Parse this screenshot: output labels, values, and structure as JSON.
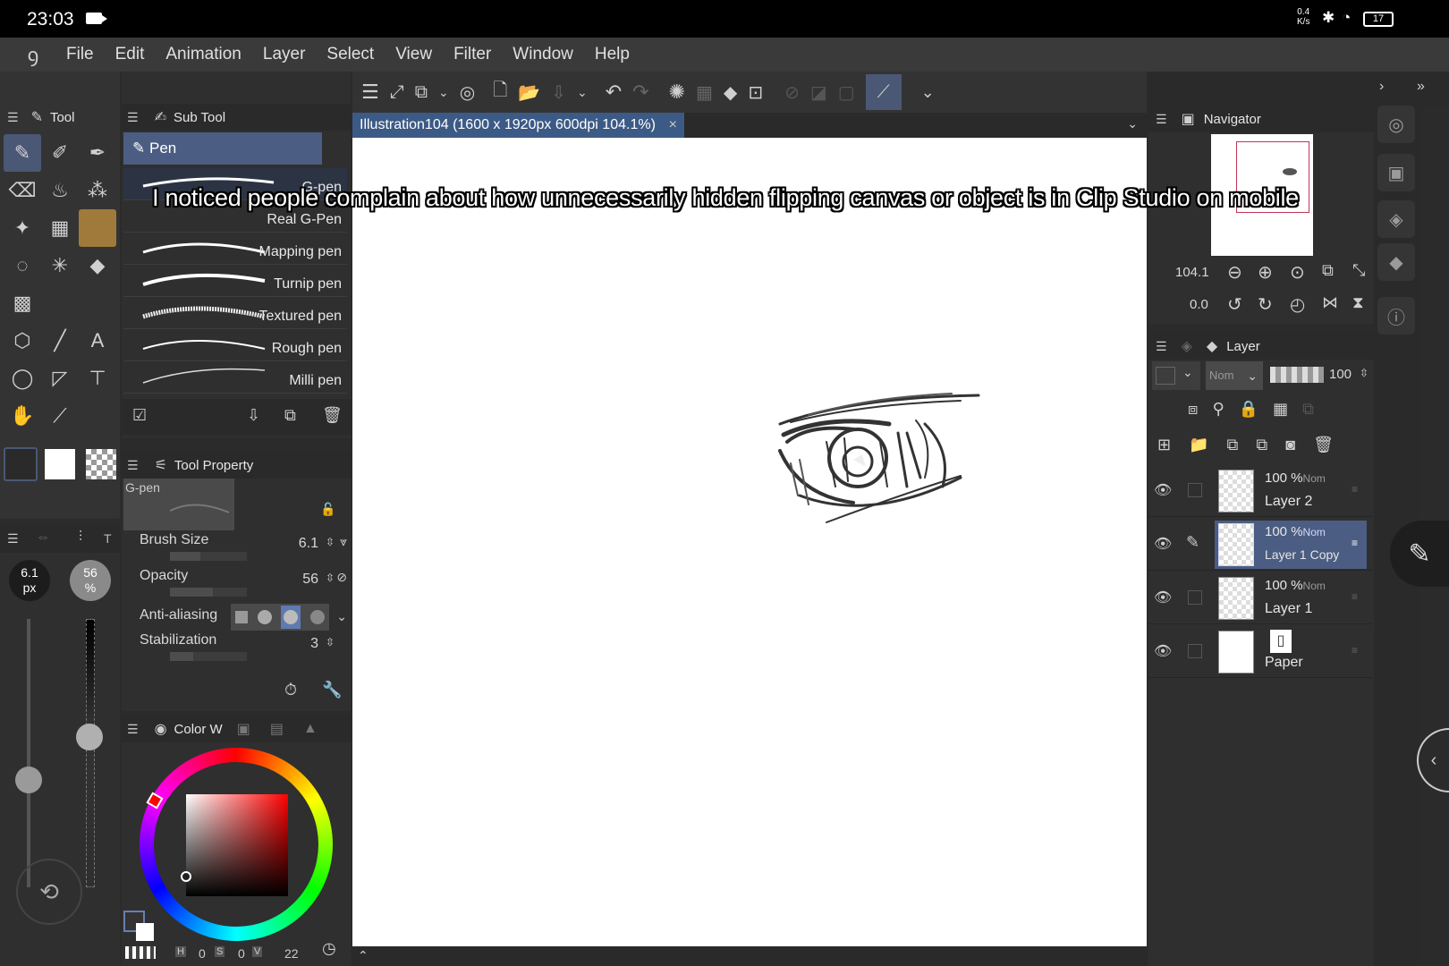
{
  "status": {
    "time": "23:03",
    "net_value": "0.4",
    "net_unit": "K/s",
    "battery": "17"
  },
  "menu": [
    "File",
    "Edit",
    "Animation",
    "Layer",
    "Select",
    "View",
    "Filter",
    "Window",
    "Help"
  ],
  "panels": {
    "tool": "Tool",
    "subtool": "Sub Tool",
    "subtool_group": "Pen",
    "tool_property": "Tool Property",
    "navigator": "Navigator",
    "layer": "Layer",
    "color": "Color W"
  },
  "brushes": [
    "G-pen",
    "Real G-Pen",
    "Mapping pen",
    "Turnip pen",
    "Textured pen",
    "Rough pen",
    "Milli pen"
  ],
  "tool_property": {
    "preview_label": "G-pen",
    "brush_size_label": "Brush Size",
    "brush_size": "6.1",
    "brush_size_fraction": 0.4,
    "opacity_label": "Opacity",
    "opacity": "56",
    "opacity_fraction": 0.56,
    "antialiasing_label": "Anti-aliasing",
    "stabilization_label": "Stabilization",
    "stabilization": "3",
    "stabilization_fraction": 0.3
  },
  "quick": {
    "size_value": "6.1",
    "size_unit": "px",
    "opacity_value": "56",
    "opacity_unit": "%"
  },
  "document_tab": "Illustration104 (1600 x 1920px 600dpi 104.1%)",
  "navigator": {
    "zoom": "104.1",
    "rotation": "0.0"
  },
  "layer_panel": {
    "blend_mode": "Nom",
    "opacity": "100"
  },
  "layers": [
    {
      "opacity": "100 %",
      "mode": "Nom",
      "name": "Layer 2",
      "selected": false
    },
    {
      "opacity": "100 %",
      "mode": "Nom",
      "name": "Layer 1 Copy",
      "selected": true
    },
    {
      "opacity": "100 %",
      "mode": "Nom",
      "name": "Layer 1",
      "selected": false
    },
    {
      "opacity": "",
      "mode": "",
      "name": "Paper",
      "selected": false
    }
  ],
  "color": {
    "h_label": "H",
    "h": "0",
    "s_label": "S",
    "s": "0",
    "v_label": "V",
    "v": "22"
  },
  "caption": "I noticed people complain about how unnecessarily hidden flipping canvas or object is in Clip Studio on mobile",
  "colors": {
    "accent": "#3c5a86",
    "selected_tool": "#4a5875",
    "panel": "#2f2f2f"
  }
}
